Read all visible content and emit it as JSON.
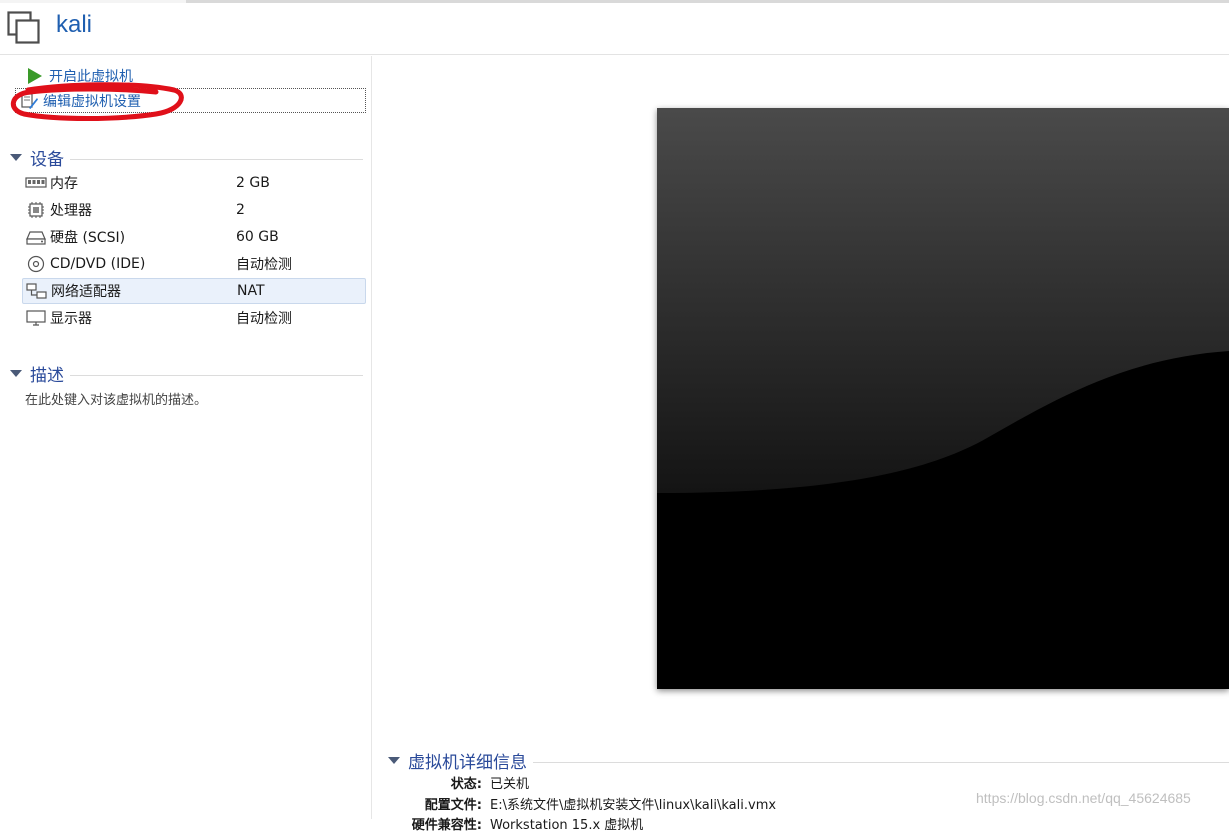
{
  "vm": {
    "title": "kali"
  },
  "actions": {
    "power_on": "开启此虚拟机",
    "edit_settings": "编辑虚拟机设置"
  },
  "devices": {
    "heading": "设备",
    "items": [
      {
        "name": "内存",
        "value": "2 GB",
        "icon": "memory-icon"
      },
      {
        "name": "处理器",
        "value": "2",
        "icon": "processor-icon"
      },
      {
        "name": "硬盘 (SCSI)",
        "value": "60 GB",
        "icon": "hard-disk-icon"
      },
      {
        "name": "CD/DVD (IDE)",
        "value": "自动检测",
        "icon": "cd-dvd-icon"
      },
      {
        "name": "网络适配器",
        "value": "NAT",
        "icon": "network-adapter-icon",
        "selected": true
      },
      {
        "name": "显示器",
        "value": "自动检测",
        "icon": "display-icon"
      }
    ]
  },
  "description": {
    "heading": "描述",
    "placeholder": "在此处键入对该虚拟机的描述。"
  },
  "details": {
    "heading": "虚拟机详细信息",
    "rows": [
      {
        "key": "状态:",
        "value": "已关机"
      },
      {
        "key": "配置文件:",
        "value": "E:\\系统文件\\虚拟机安装文件\\linux\\kali\\kali.vmx"
      },
      {
        "key": "硬件兼容性:",
        "value": "Workstation 15.x 虚拟机"
      }
    ]
  },
  "watermark": "https://blog.csdn.net/qq_45624685",
  "colors": {
    "accent": "#1f5fb0",
    "play": "#3a9a29",
    "annotation": "#e0101a"
  }
}
